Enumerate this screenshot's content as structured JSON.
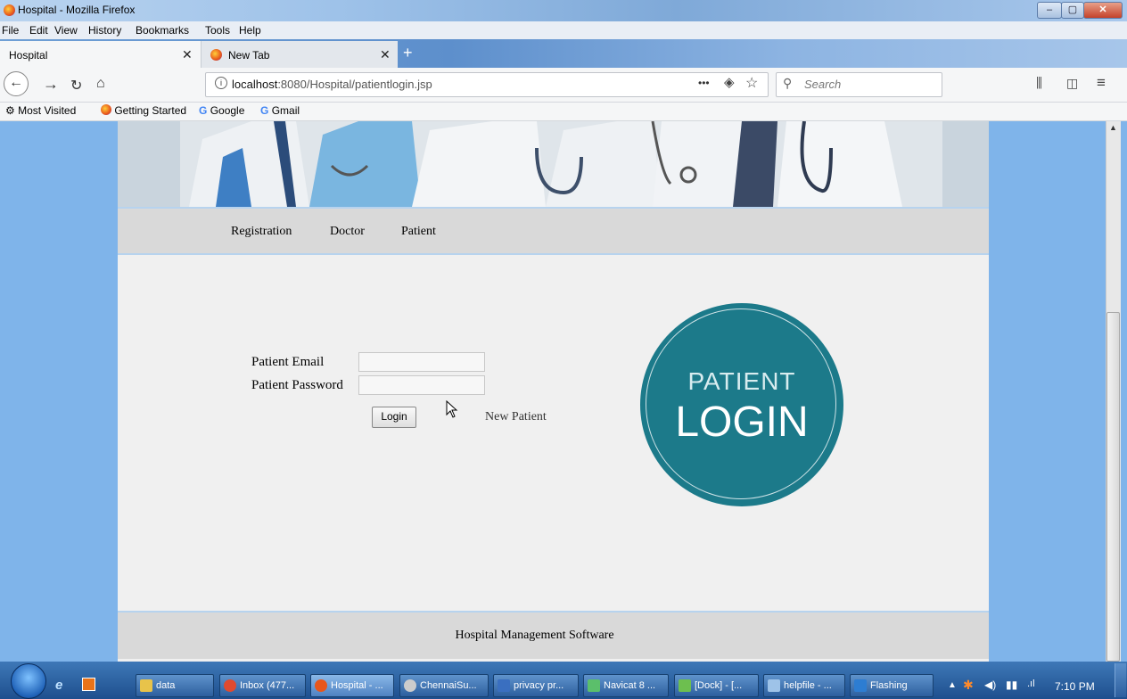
{
  "window": {
    "title": "Hospital - Mozilla Firefox"
  },
  "menu": [
    "File",
    "Edit",
    "View",
    "History",
    "Bookmarks",
    "Tools",
    "Help"
  ],
  "tabs": [
    {
      "label": "Hospital",
      "active": true
    },
    {
      "label": "New Tab",
      "active": false
    }
  ],
  "urlbar": {
    "host": "localhost",
    "rest": ":8080/Hospital/patientlogin.jsp",
    "more": "•••"
  },
  "search": {
    "placeholder": "Search"
  },
  "bookmarks": [
    "Most Visited",
    "Getting Started",
    "Google",
    "Gmail"
  ],
  "site_nav": [
    "Registration",
    "Doctor",
    "Patient"
  ],
  "form": {
    "email_label": "Patient Email",
    "email_value": "",
    "password_label": "Patient Password",
    "password_value": "",
    "login_label": "Login",
    "new_patient_label": "New Patient"
  },
  "badge": {
    "line1": "PATIENT",
    "line2": "LOGIN",
    "color": "#1c7a8a"
  },
  "footer": {
    "text": "Hospital Management Software"
  },
  "taskbar": {
    "items": [
      "data",
      "Inbox (477...",
      "Hospital - ...",
      "ChennaiSu...",
      "privacy pr...",
      "Navicat 8 ...",
      "[Dock] - [...",
      "helpfile - ...",
      "Flashing"
    ],
    "clock": "7:10 PM"
  }
}
